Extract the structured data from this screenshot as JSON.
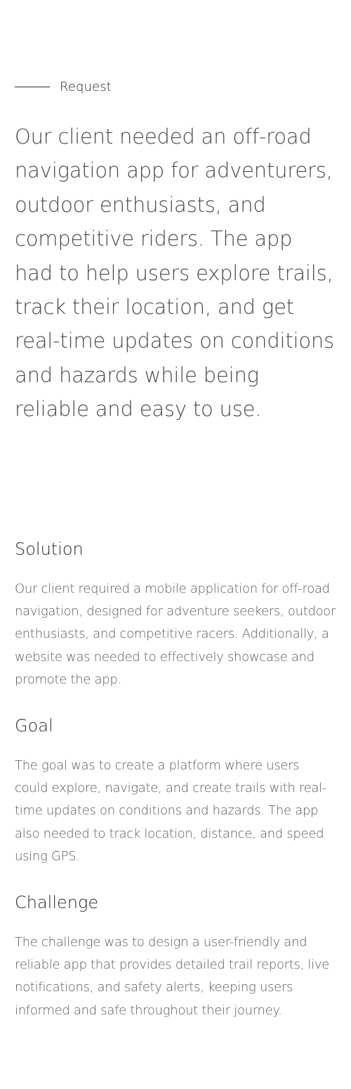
{
  "request": {
    "label": "Request",
    "text": "Our client needed an off-road navigation app for adventurers, outdoor enthusiasts, and competitive riders. The app had to help users explore trails, track their location, and get real-time updates on conditions and hazards while being reliable and easy to use."
  },
  "sections": {
    "solution": {
      "title": "Solution",
      "body": "Our client required a mobile application for off-road navigation, designed for adventure seekers, outdoor enthusiasts, and competitive racers. Additionally, a website was needed to effectively showcase and promote the app."
    },
    "goal": {
      "title": "Goal",
      "body": "The goal was to create a platform where users could explore, navigate, and create trails with real-time updates on conditions and hazards. The app also needed to track location, distance, and speed using GPS."
    },
    "challenge": {
      "title": "Challenge",
      "body": "The challenge was to design a user-friendly and reliable app that provides detailed trail reports, live notifications, and safety alerts, keeping users informed and safe throughout their journey."
    }
  }
}
